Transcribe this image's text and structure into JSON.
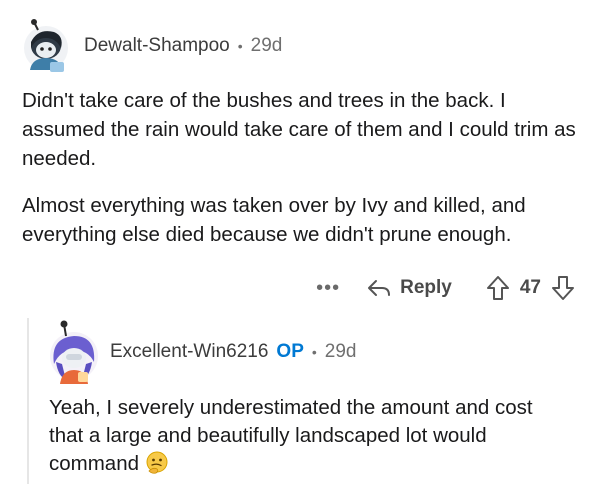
{
  "comment1": {
    "username": "Dewalt-Shampoo",
    "separator": "•",
    "age": "29d",
    "paragraphs": [
      "Didn't take care of the bushes and trees in the back. I assumed the rain would take care of them and I could trim as needed.",
      "Almost everything was taken over by Ivy and killed, and everything else died because we didn't prune enough."
    ],
    "actions": {
      "more_label": "•••",
      "reply_label": "Reply",
      "vote_count": "47"
    }
  },
  "comment2": {
    "username": "Excellent-Win6216",
    "op_badge": "OP",
    "separator": "•",
    "age": "29d",
    "text": "Yeah, I severely underestimated the amount and cost that a large and beautifully landscaped lot would command",
    "emoji": "thinking-face-icon"
  },
  "colors": {
    "op_blue": "#0079d3",
    "text": "#1a1a1b",
    "meta_gray": "#6f6f6f"
  }
}
